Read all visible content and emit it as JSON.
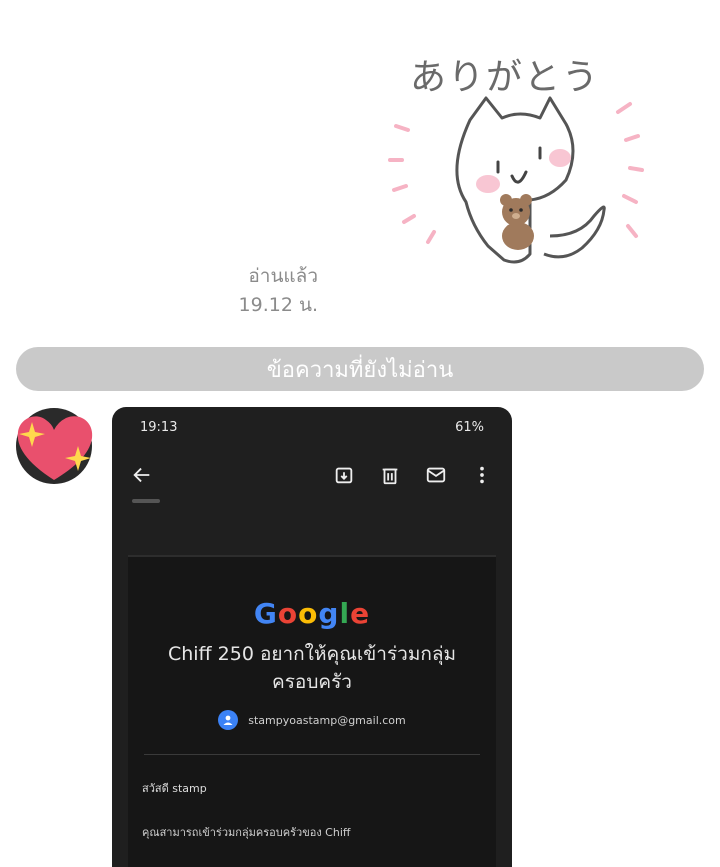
{
  "sticker": {
    "text": "ありがとう",
    "icon": "cat-holding-teddy-bear-sticker"
  },
  "read_receipt": {
    "status": "อ่านแล้ว",
    "time": "19.12 น."
  },
  "unread_divider": {
    "label": "ข้อความที่ยังไม่อ่าน"
  },
  "sender": {
    "avatar_icon": "sparkling-heart-icon"
  },
  "screenshot": {
    "status_time": "19:13",
    "status_right": "61%",
    "toolbar_icons": [
      "back-arrow-icon",
      "archive-icon",
      "delete-icon",
      "mail-icon",
      "more-vert-icon"
    ],
    "email": {
      "logo": "Google",
      "title": "Chiff 250 อยากให้คุณเข้าร่วมกลุ่มครอบครัว",
      "account": "stampyoastamp@gmail.com",
      "greeting": "สวัสดี stamp",
      "body": "คุณสามารถเข้าร่วมกลุ่มครอบครัวของ Chiff"
    }
  },
  "colors": {
    "background": "#ffffff",
    "unread_bar": "#c9c9c9",
    "meta_text": "#8b8b8b",
    "dark_bg": "#1f1f1f",
    "google_blue": "#4285F4",
    "google_red": "#EA4335",
    "google_yellow": "#FBBC05",
    "google_green": "#34A853"
  }
}
